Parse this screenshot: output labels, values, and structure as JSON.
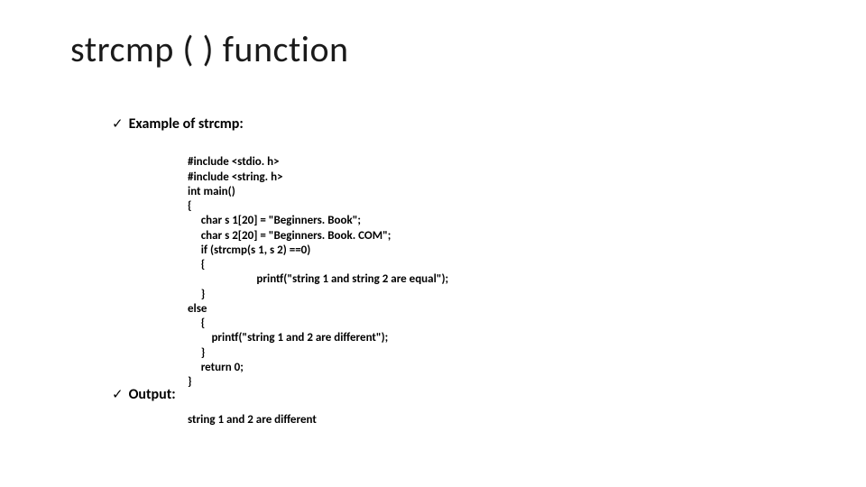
{
  "title": "strcmp ( ) function",
  "bullets": {
    "example_label": "Example of strcmp:",
    "output_label": "Output:"
  },
  "code_lines": [
    "#include <stdio. h>",
    "#include <string. h>",
    "int main()",
    "{",
    "     char s 1[20] = \"Beginners. Book\";",
    "     char s 2[20] = \"Beginners. Book. COM\";",
    "     if (strcmp(s 1, s 2) ==0)",
    "     {",
    "                          printf(\"string 1 and string 2 are equal\");",
    "     }",
    "else",
    "     {",
    "         printf(\"string 1 and 2 are different\");",
    "     }",
    "     return 0;",
    "}"
  ],
  "output_text": "string 1 and 2 are different",
  "check_glyph": "✓"
}
